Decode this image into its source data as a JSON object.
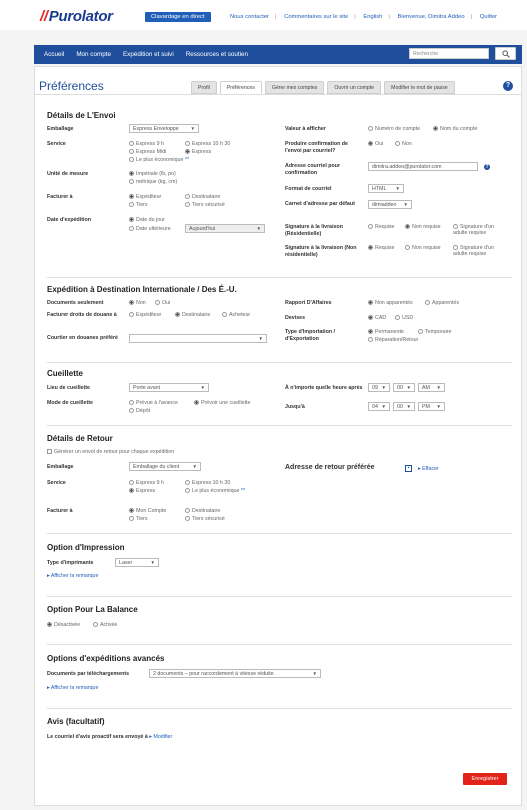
{
  "header": {
    "logo": "Purolator",
    "chat": "Clavardage en direct",
    "links": [
      "Nous contacter",
      "Commentaires sur le site",
      "English",
      "Bienvenue, Dimitra Addeo",
      "Quitter"
    ]
  },
  "nav": {
    "items": [
      "Accueil",
      "Mon compte",
      "Expédition et suivi",
      "Ressources et soutien"
    ],
    "search_placeholder": "Recherche"
  },
  "page": {
    "title": "Préférences",
    "tabs": [
      "Profil",
      "Préférences",
      "Gérer mes comptes",
      "Ouvrir un compte",
      "Modifier le mot de passe"
    ],
    "help": "?"
  },
  "envoi": {
    "title": "Détails de L'Envoi",
    "emballage_label": "Emballage",
    "emballage_value": "Express Enveloppe",
    "service_label": "Service",
    "service_opts": [
      "Express 9 h",
      "Express 10 h 30",
      "Express Midi",
      "Express",
      "Le plus économique"
    ],
    "star": "**",
    "unite_label": "Unité de mesure",
    "unite_opts": [
      "Impériale (lb, po)",
      "métrique (kg, cm)"
    ],
    "facturer_label": "Facturer à",
    "facturer_opts": [
      "Expéditeur",
      "Destinataire",
      "Tiers",
      "Tiers sécurisé"
    ],
    "date_label": "Date d'expédition",
    "date_opts": [
      "Date du jour",
      "Date ultérieure"
    ],
    "date_value": "Aujourd'hui",
    "valeur_label": "Valeur à afficher",
    "valeur_opts": [
      "Numéro de compte",
      "Nom du compte"
    ],
    "confirm_label": "Produire confirmation de l'envoi par courriel?",
    "confirm_opts": [
      "Oui",
      "Non"
    ],
    "adresse_label": "Adresse courriel pour confirmation",
    "adresse_value": "dimitra.addeo@purolator.com",
    "format_label": "Format de courriel",
    "format_value": "HTML",
    "carnet_label": "Carnet d'adresse par défaut",
    "carnet_value": "dimiaddeo",
    "sig_res_label": "Signature à la livraison (Résidentielle)",
    "sig_opts": [
      "Requise",
      "Non requise",
      "Signature d'un adulte requise"
    ],
    "sig_nonres_label": "Signature à la livraison (Non résidentielle)"
  },
  "intl": {
    "title": "Expédition à Destination Internationale / Des É.-U.",
    "docs_label": "Documents seulement",
    "docs_opts": [
      "Non",
      "Oui"
    ],
    "droits_label": "Facturer droits de douane à",
    "droits_opts": [
      "Expéditeur",
      "Destinataire",
      "Acheteur"
    ],
    "courtier_label": "Courtier en douanes préféré",
    "rapport_label": "Rapport D'Affaires",
    "rapport_opts": [
      "Non apparentés",
      "Apparentés"
    ],
    "devises_label": "Devises",
    "devises_opts": [
      "CAD",
      "USD"
    ],
    "type_label": "Type d'Importation / d'Exportation",
    "type_opts": [
      "Permanente",
      "Temporaire",
      "Réparation/Retour"
    ]
  },
  "cueillette": {
    "title": "Cueillette",
    "lieu_label": "Lieu de cueillette",
    "lieu_value": "Porte avant",
    "mode_label": "Mode de cueillette",
    "mode_opts": [
      "Prévue à l'avance",
      "Prévoir une cueillette",
      "Dépôt"
    ],
    "heure_label": "À n'importe quelle heure après",
    "heure": [
      "09",
      "00",
      "AM"
    ],
    "jusqua_label": "Jusqu'à",
    "jusqua": [
      "04",
      "00",
      "PM"
    ]
  },
  "retour": {
    "title": "Détails de Retour",
    "generer": "Générer un envoi de retour pour chaque expédition",
    "emballage_label": "Emballage",
    "emballage_value": "Emballage du client",
    "service_label": "Service",
    "service_opts": [
      "Express 9 h",
      "Express 10 h 30",
      "Express",
      "Le plus économique"
    ],
    "facturer_label": "Facturer à",
    "facturer_opts": [
      "Mon Compte",
      "Destinataire",
      "Tiers",
      "Tiers sécurisé"
    ],
    "adresse_title": "Adresse de retour préférée",
    "effacer": "Effacer"
  },
  "impression": {
    "title": "Option d'Impression",
    "type_label": "Type d'imprimante",
    "type_value": "Laser",
    "remarque": "Afficher la remarque"
  },
  "balance": {
    "title": "Option Pour La Balance",
    "opts": [
      "Désactivée",
      "Activée"
    ]
  },
  "avances": {
    "title": "Options d'expéditions avancés",
    "docs_label": "Documents par téléchargements",
    "docs_value": "2 documents – pour raccordement à vitesse réduite",
    "remarque": "Afficher la remarque"
  },
  "avis": {
    "title": "Avis (facultatif)",
    "text": "Le courriel d'avis proactif sera envoyé à",
    "modifier": "Modifier"
  },
  "save": "Enregistrer"
}
